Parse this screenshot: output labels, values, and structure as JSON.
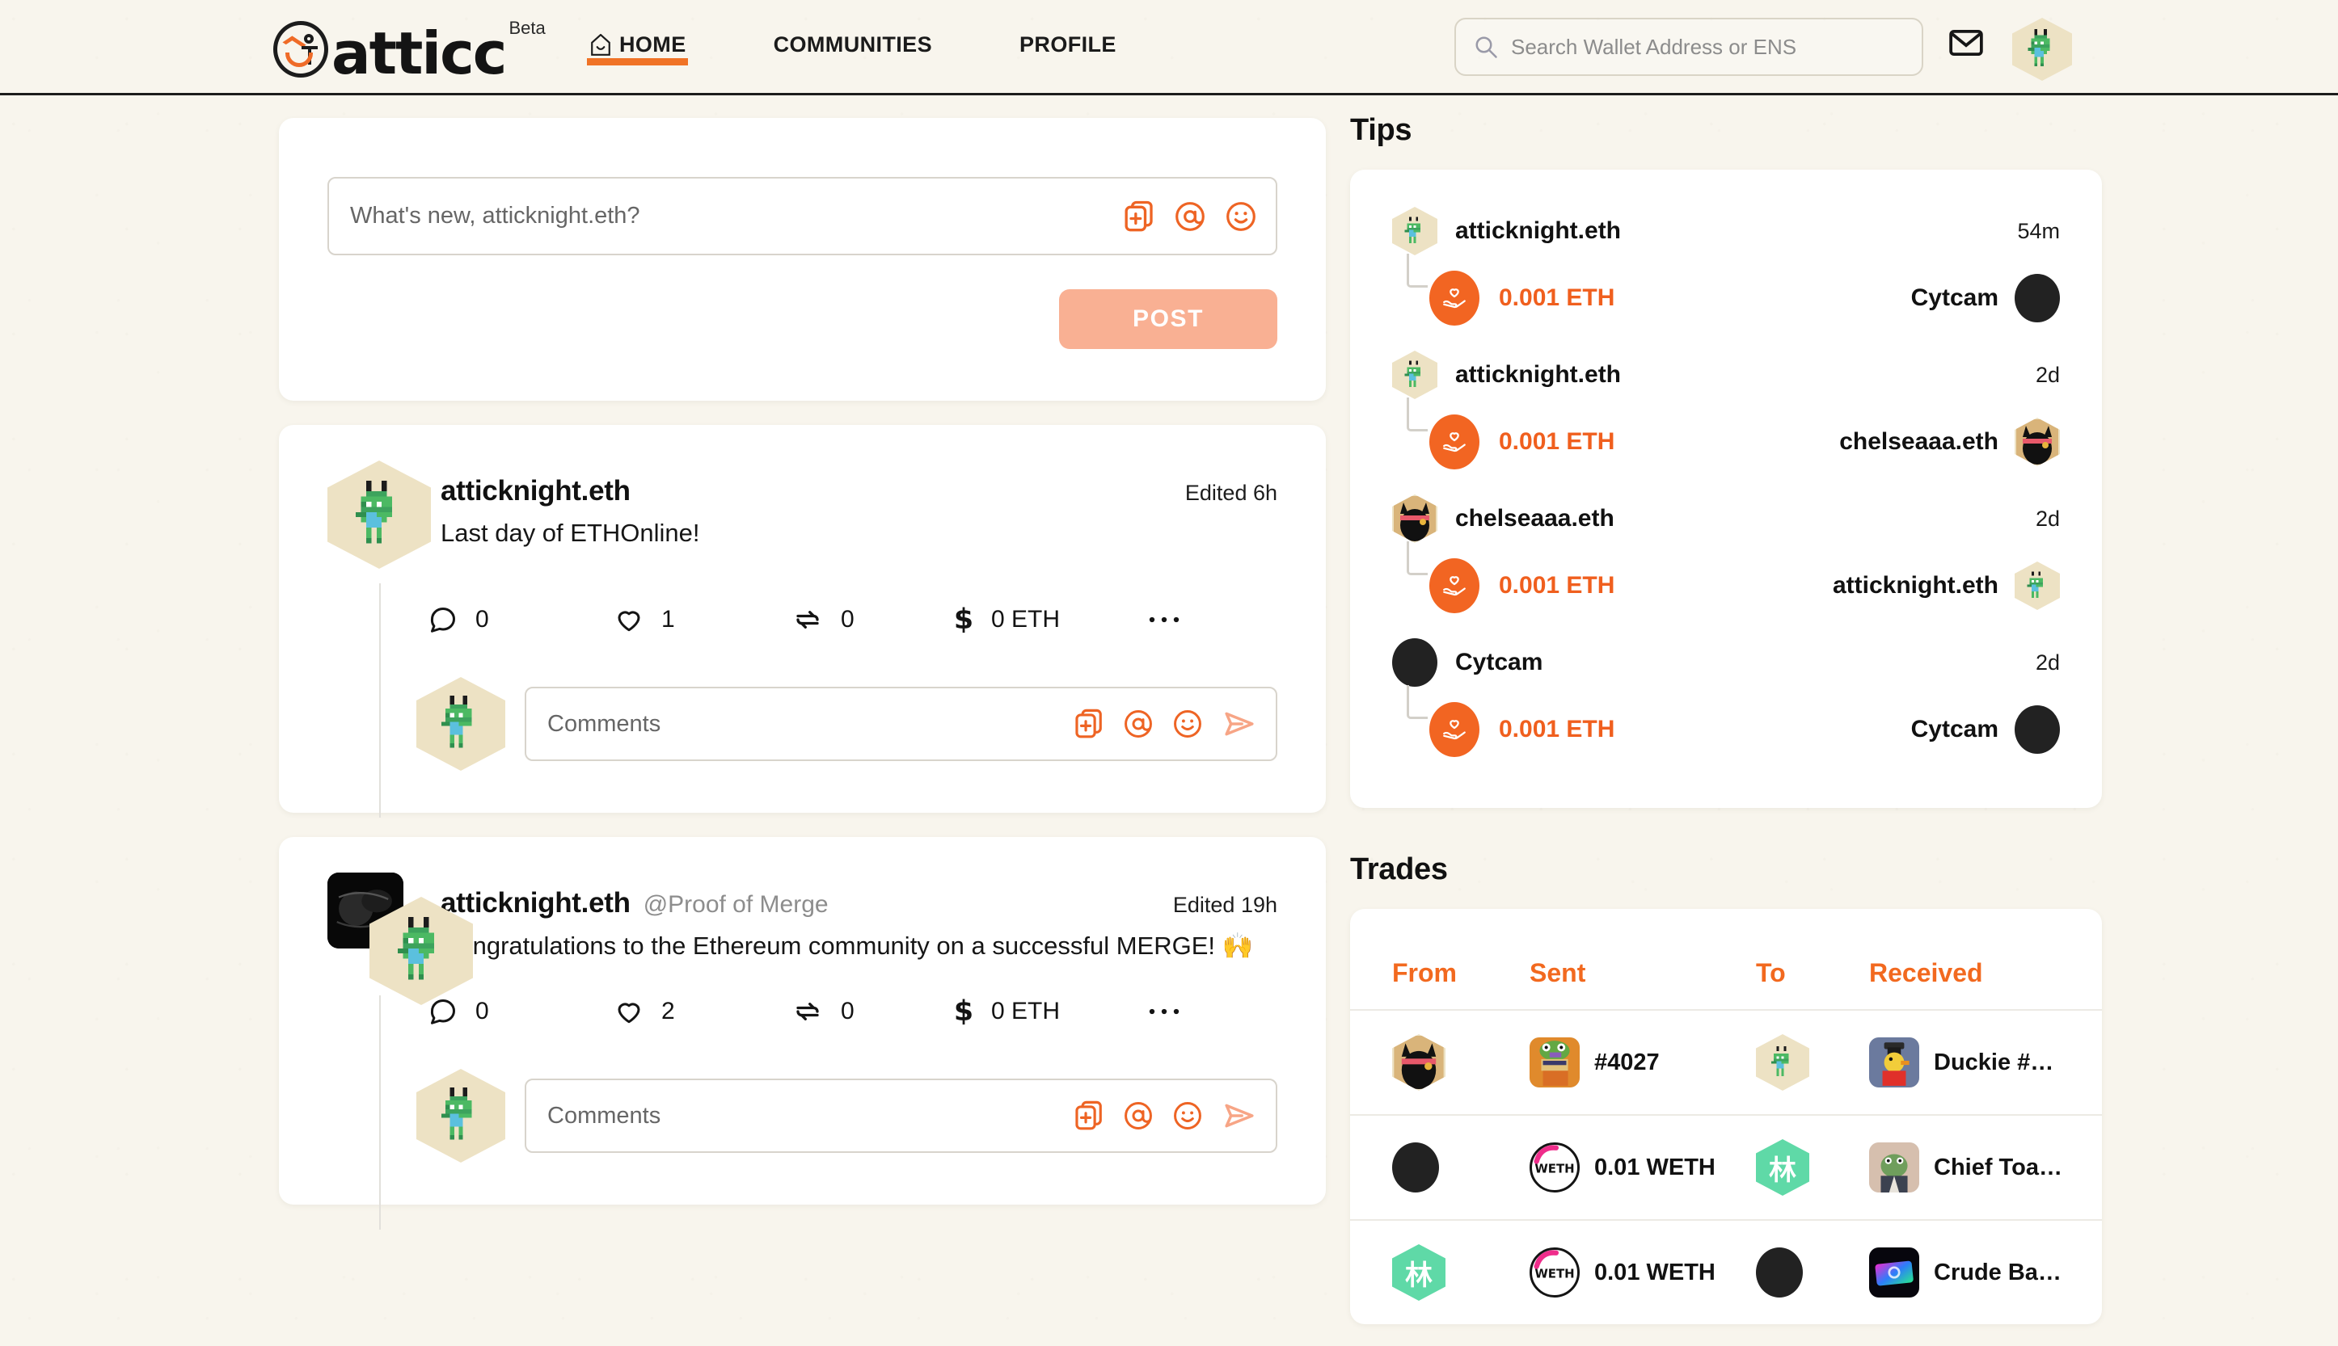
{
  "brand": {
    "name": "atticc",
    "tag": "Beta",
    "logo_icon": "atticc-face-logo"
  },
  "nav": [
    {
      "label": "HOME",
      "icon": "home-icon",
      "active": true
    },
    {
      "label": "COMMUNITIES",
      "icon": "",
      "active": false
    },
    {
      "label": "PROFILE",
      "icon": "",
      "active": false
    }
  ],
  "search": {
    "placeholder": "Search Wallet Address or ENS",
    "value": "",
    "icon": "search-icon"
  },
  "header_icons": {
    "mail": "envelope-icon",
    "avatar": "user-avatar-hex"
  },
  "composer": {
    "placeholder": "What's new, atticknight.eth?",
    "value": "",
    "post_label": "POST",
    "tools": [
      "image-upload-icon",
      "mention-icon",
      "emoji-icon"
    ]
  },
  "posts": [
    {
      "author": "atticknight.eth",
      "community": "",
      "edited": "Edited 6h",
      "text": "Last day of ETHOnline!",
      "comments": "0",
      "likes": "1",
      "reposts": "0",
      "tips": "0 ETH",
      "comment_placeholder": "Comments",
      "has_community_badge": false
    },
    {
      "author": "atticknight.eth",
      "community": "@Proof of Merge",
      "edited": "Edited 19h",
      "text": "Congratulations to the Ethereum community on a successful MERGE! 🙌",
      "comments": "0",
      "likes": "2",
      "reposts": "0",
      "tips": "0 ETH",
      "comment_placeholder": "Comments",
      "has_community_badge": true
    }
  ],
  "post_action_icons": [
    "comment-icon",
    "heart-icon",
    "repost-icon",
    "dollar-icon",
    "more-options-icon"
  ],
  "comment_tools": [
    "image-upload-icon",
    "mention-icon",
    "emoji-icon",
    "send-icon"
  ],
  "tips": {
    "title": "Tips",
    "items": [
      {
        "from": "atticknight.eth",
        "from_avatar": "hex-knight",
        "time": "54m",
        "amount": "0.001 ETH",
        "to": "Cytcam",
        "to_avatar": "circle-dark"
      },
      {
        "from": "atticknight.eth",
        "from_avatar": "hex-knight",
        "time": "2d",
        "amount": "0.001 ETH",
        "to": "chelseaaa.eth",
        "to_avatar": "hex-cat"
      },
      {
        "from": "chelseaaa.eth",
        "from_avatar": "hex-cat",
        "time": "2d",
        "amount": "0.001 ETH",
        "to": "atticknight.eth",
        "to_avatar": "hex-knight"
      },
      {
        "from": "Cytcam",
        "from_avatar": "circle-dark",
        "time": "2d",
        "amount": "0.001 ETH",
        "to": "Cytcam",
        "to_avatar": "circle-dark"
      }
    ],
    "tip_icon": "hand-holding-heart-icon"
  },
  "trades": {
    "title": "Trades",
    "columns": [
      "From",
      "Sent",
      "To",
      "Received"
    ],
    "rows": [
      {
        "from_avatar": "hex-cat",
        "sent_token": "pepe-nft",
        "sent_label": "#4027",
        "to_avatar": "hex-knight",
        "recv_token": "duckie-nft",
        "recv_label": "Duckie #…"
      },
      {
        "from_avatar": "circle-dark",
        "sent_token": "weth-coin",
        "sent_label": "0.01 WETH",
        "to_avatar": "hex-green-lin",
        "recv_token": "toad-nft",
        "recv_label": "Chief Toa…"
      },
      {
        "from_avatar": "hex-green-lin",
        "sent_token": "weth-coin",
        "sent_label": "0.01 WETH",
        "to_avatar": "circle-dark",
        "recv_token": "crude-nft",
        "recv_label": "Crude Ba…"
      }
    ]
  },
  "colors": {
    "accent": "#f26522",
    "accent_soft": "#f9b093",
    "background": "#f8f5ed",
    "card": "#ffffff",
    "hex_beige": "#ede2c4",
    "hex_green": "#5fd9a7",
    "text": "#121212"
  }
}
